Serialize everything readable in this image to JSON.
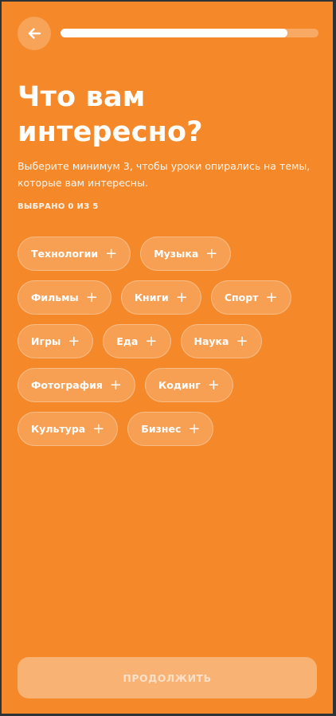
{
  "header": {
    "back_icon": "arrow-left-icon",
    "progress": 0.88
  },
  "title": "Что вам интересно?",
  "subtitle": "Выберите минимум 3, чтобы уроки опирались на темы, которые вам интересны.",
  "counter": "ВЫБРАНО 0 ИЗ 5",
  "topics": {
    "plus_symbol": "+",
    "rows": [
      [
        "Технологии",
        "Музыка"
      ],
      [
        "Фильмы",
        "Книги",
        "Спорт"
      ],
      [
        "Игры",
        "Еда",
        "Наука"
      ],
      [
        "Фотография",
        "Кодинг"
      ],
      [
        "Культура",
        "Бизнес"
      ]
    ]
  },
  "continue_label": "ПРОДОЛЖИТЬ",
  "colors": {
    "background": "#f5892a",
    "frame": "#2e3338",
    "text": "#ffffff"
  }
}
